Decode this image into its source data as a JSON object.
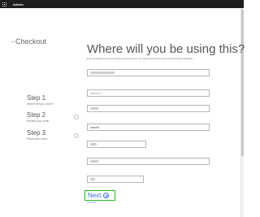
{
  "topbar": {
    "title": "Admin"
  },
  "checkout": {
    "label": "Checkout"
  },
  "header": {
    "title": "Where will you be using this?",
    "subtitle": "Enter the address where you will be using this service. The address determines taxes and subscription availability."
  },
  "steps": [
    {
      "title": "Step 1",
      "desc": "Where will you use it?"
    },
    {
      "title": "Step 2",
      "desc": "Review your order"
    },
    {
      "title": "Step 3",
      "desc": "Place your order"
    }
  ],
  "form": {
    "address1": {
      "value": ""
    },
    "address2": {
      "placeholder": "Address 2"
    },
    "city": {
      "value": ""
    },
    "state": {
      "value": "victoria"
    },
    "postal": {
      "value": ""
    },
    "country": {
      "value": ""
    },
    "phone": {
      "value": ""
    }
  },
  "actions": {
    "next_label": "Next",
    "cancel_label": "Cancel"
  },
  "colors": {
    "accent": "#3a6fd8",
    "highlight": "#22bb22",
    "topbar": "#1e1e1e"
  }
}
